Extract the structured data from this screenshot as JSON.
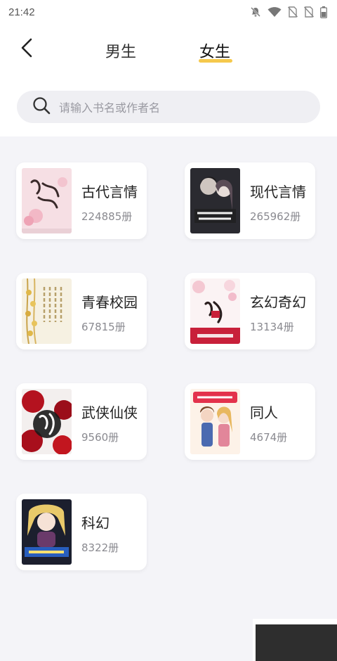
{
  "status_bar": {
    "time": "21:42",
    "icons": [
      "notifications-off-icon",
      "wifi-icon",
      "no-sim-icon",
      "no-sim-icon",
      "battery-icon"
    ]
  },
  "header": {
    "back_icon": "back-arrow-icon",
    "tabs": [
      {
        "label": "男生",
        "active": false
      },
      {
        "label": "女生",
        "active": true
      }
    ],
    "accent_color": "#f5c94c"
  },
  "search": {
    "icon": "search-icon",
    "placeholder": "请输入书名或作者名"
  },
  "categories": [
    {
      "title": "古代言情",
      "count": "224885册"
    },
    {
      "title": "现代言情",
      "count": "265962册"
    },
    {
      "title": "青春校园",
      "count": "67815册"
    },
    {
      "title": "玄幻奇幻",
      "count": "13134册"
    },
    {
      "title": "武侠仙侠",
      "count": "9560册"
    },
    {
      "title": "同人",
      "count": "4674册"
    },
    {
      "title": "科幻",
      "count": "8322册"
    }
  ]
}
